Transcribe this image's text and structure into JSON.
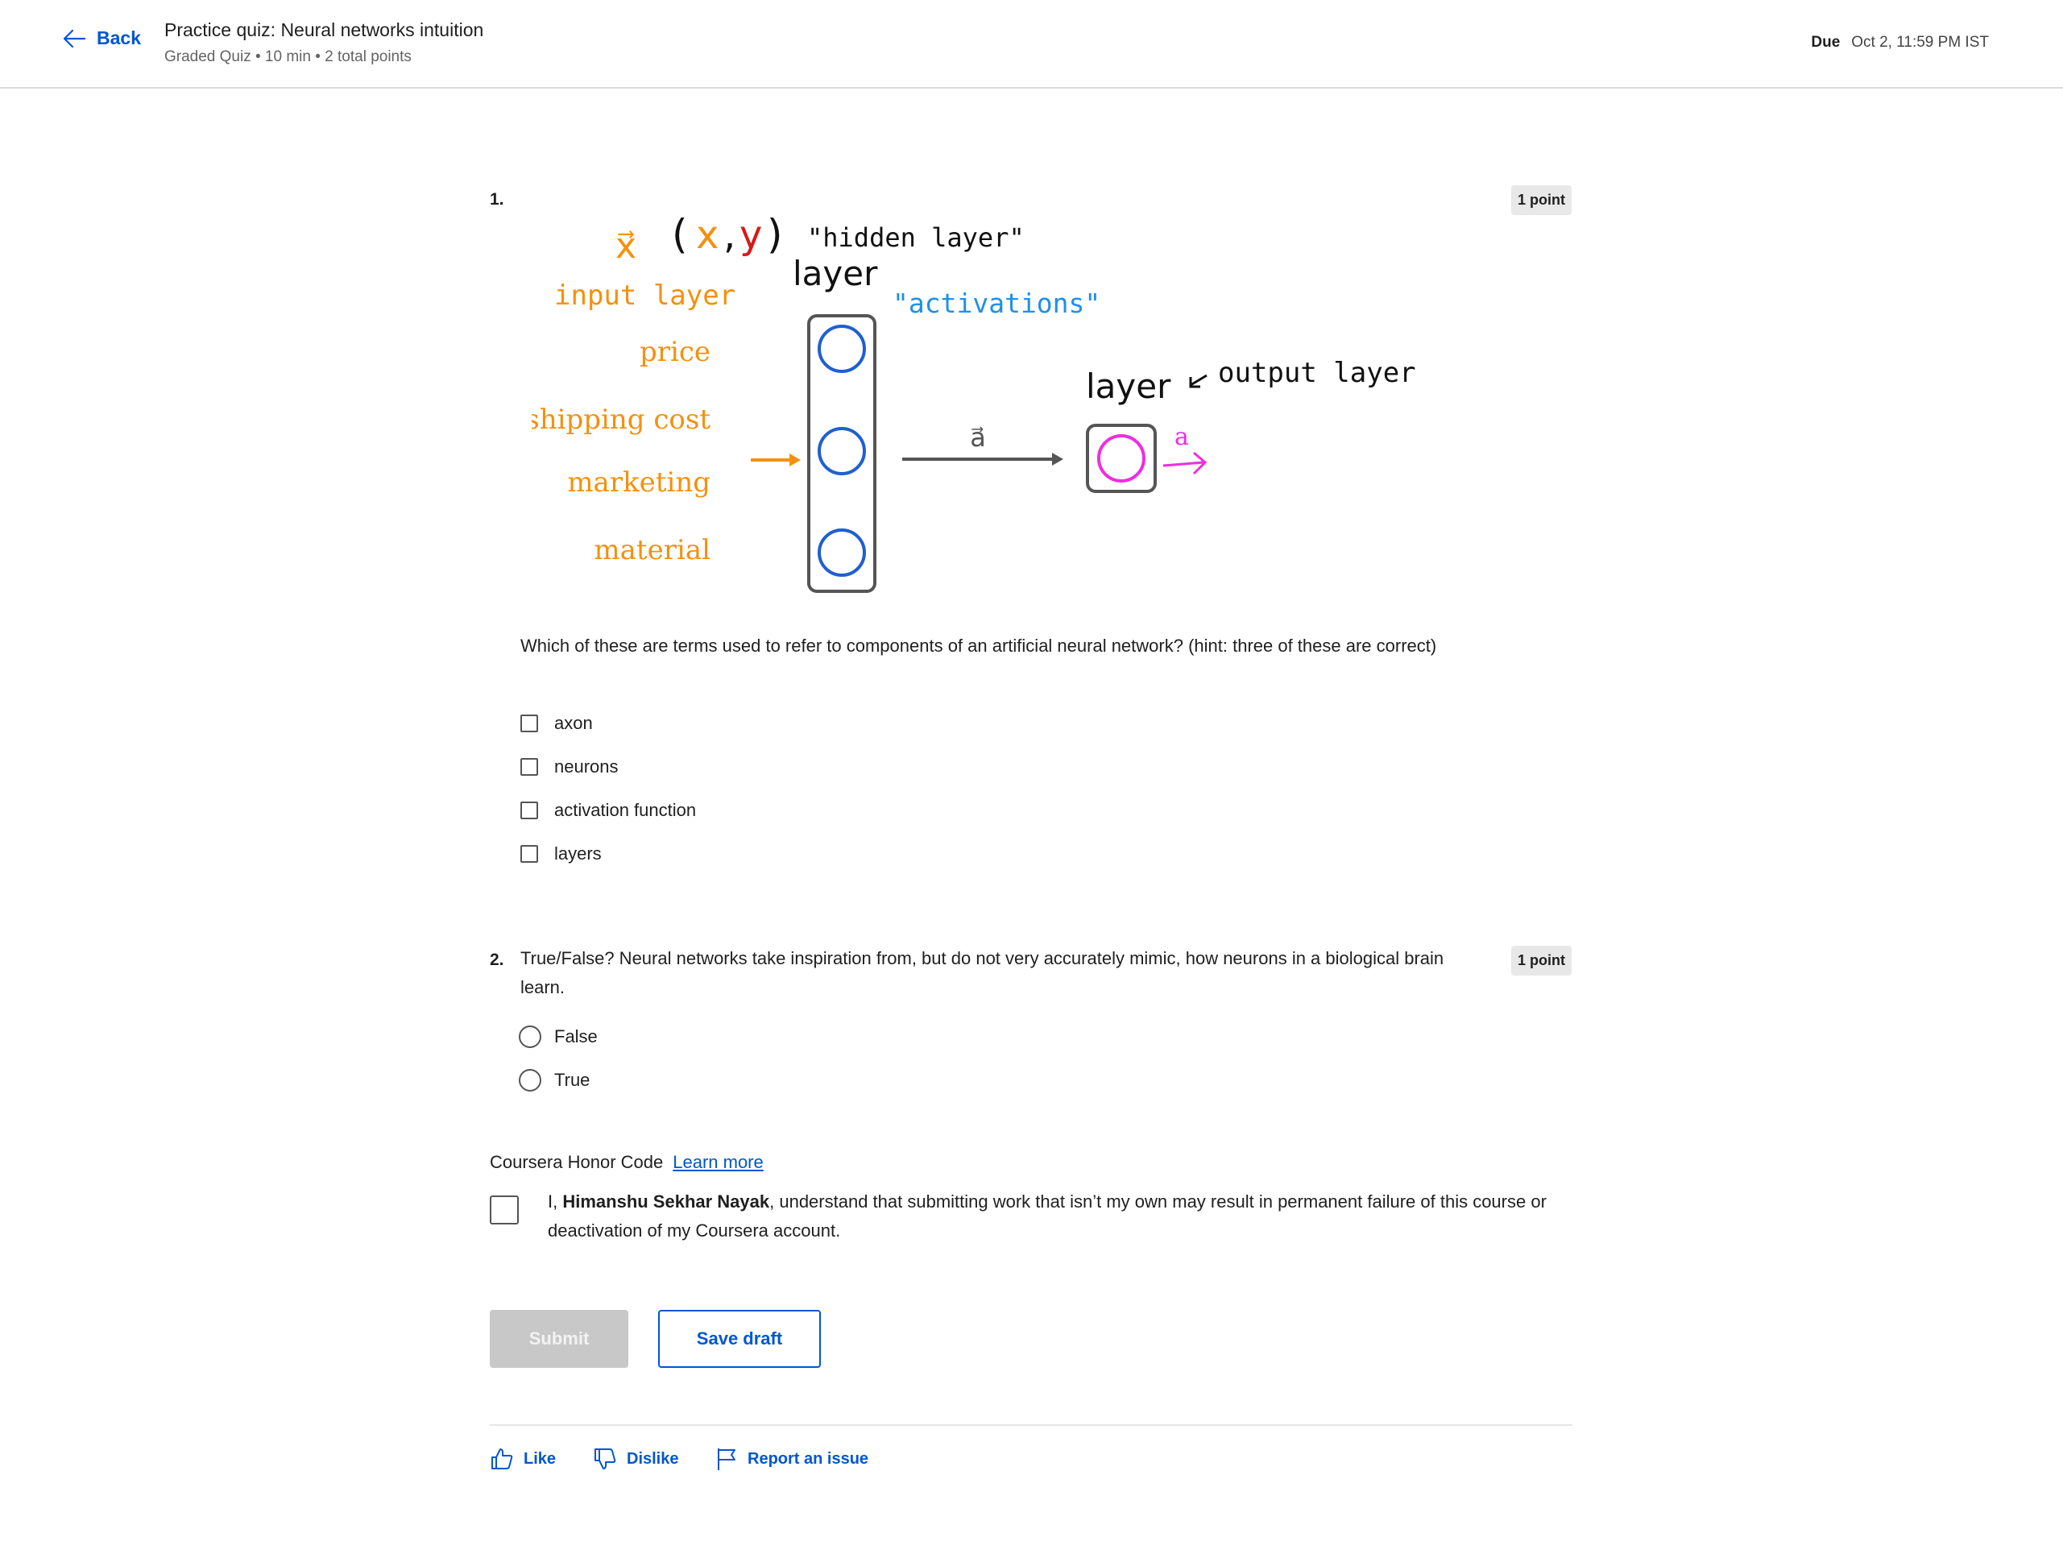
{
  "header": {
    "back_label": "Back",
    "title": "Practice quiz: Neural networks intuition",
    "subtitle": "Graded Quiz • 10 min • 2 total points",
    "due_label": "Due",
    "due_value": "Oct 2, 11:59 PM IST"
  },
  "question1": {
    "number": "1.",
    "points": "1 point",
    "figure": {
      "x_vec": "x⃗",
      "x": "x",
      "comma": ",",
      "y": "y",
      "open_paren": "(",
      "close_paren": ")",
      "hidden_layer": "\"hidden layer\"",
      "layer_top": "layer",
      "input_layer": "input layer",
      "activations": "\"activations\"",
      "features": [
        "price",
        "shipping cost",
        "marketing",
        "material"
      ],
      "a_vec": "a⃗",
      "layer_out": "layer",
      "output_layer": "output layer",
      "a_out": "a"
    },
    "text": "Which of these are terms used to refer to components of an artificial neural network? (hint: three of these are correct)",
    "options": [
      "axon",
      "neurons",
      "activation function",
      "layers"
    ]
  },
  "question2": {
    "number": "2.",
    "points": "1 point",
    "text": "True/False? Neural networks take inspiration from, but do not very accurately mimic, how neurons in a biological brain learn.",
    "options": [
      "False",
      "True"
    ]
  },
  "honor": {
    "title": "Coursera Honor Code",
    "learn_more": "Learn more",
    "prefix": "I, ",
    "name": "Himanshu Sekhar Nayak",
    "suffix": ", understand that submitting work that isn’t my own may result in permanent failure of this course or deactivation of my Coursera account."
  },
  "actions": {
    "submit": "Submit",
    "save_draft": "Save draft",
    "like": "Like",
    "dislike": "Dislike",
    "report": "Report an issue"
  },
  "colors": {
    "accent": "#0056d2",
    "orange": "#f5900e",
    "blue_neuron": "#1f5fd1",
    "magenta": "#ee2ee0",
    "activations_blue": "#1e90e8",
    "red_y": "#d51a1a"
  }
}
